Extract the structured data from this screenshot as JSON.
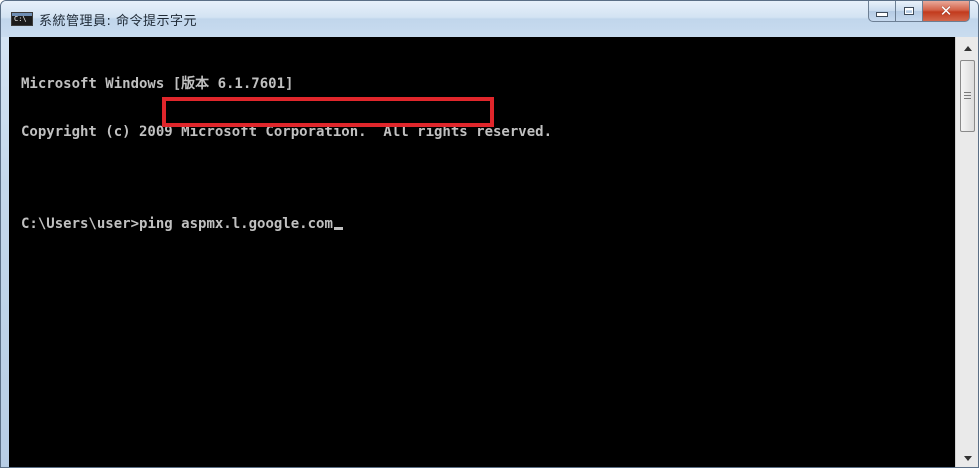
{
  "window": {
    "title": "系統管理員: 命令提示字元",
    "icon_label": "C:\\",
    "icon": "cmd-icon",
    "close_icon": "close-icon",
    "minimize_icon": "minimize-icon",
    "maximize_icon": "maximize-icon"
  },
  "console": {
    "lines": [
      "Microsoft Windows [版本 6.1.7601]",
      "Copyright (c) 2009 Microsoft Corporation.  All rights reserved."
    ],
    "prompt": "C:\\Users\\user>",
    "command": "ping aspmx.l.google.com"
  },
  "colors": {
    "console_background": "#000000",
    "console_text": "#c0c0c0",
    "highlight_border": "#e0262b",
    "close_button": "#c23a1d"
  }
}
